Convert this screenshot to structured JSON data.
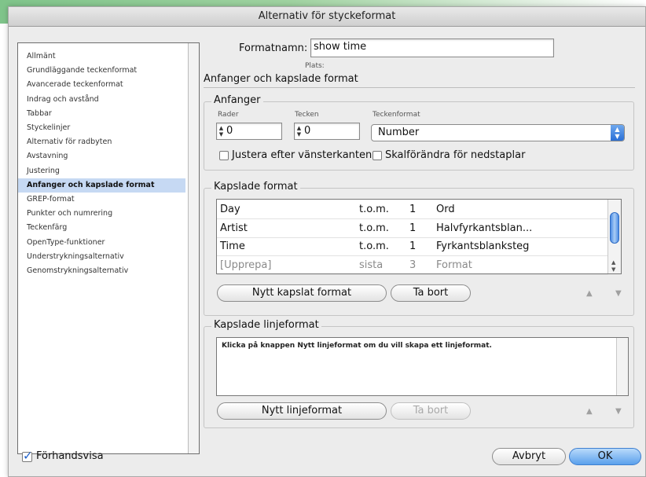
{
  "window": {
    "title": "Alternativ för styckeformat"
  },
  "sidebar": {
    "items": [
      {
        "label": "Allmänt"
      },
      {
        "label": "Grundläggande teckenformat"
      },
      {
        "label": "Avancerade teckenformat"
      },
      {
        "label": "Indrag och avstånd"
      },
      {
        "label": "Tabbar"
      },
      {
        "label": "Styckelinjer"
      },
      {
        "label": "Alternativ för radbyten"
      },
      {
        "label": "Avstavning"
      },
      {
        "label": "Justering"
      },
      {
        "label": "Anfanger och kapslade format",
        "selected": true
      },
      {
        "label": "GREP-format"
      },
      {
        "label": "Punkter och numrering"
      },
      {
        "label": "Teckenfärg"
      },
      {
        "label": "OpenType-funktioner"
      },
      {
        "label": "Understrykningsalternativ"
      },
      {
        "label": "Genomstrykningsalternativ"
      }
    ]
  },
  "header": {
    "style_name_label": "Formatnamn:",
    "style_name_value": "show time",
    "location_label": "Plats:",
    "section_title": "Anfanger och kapslade format"
  },
  "drop_caps": {
    "group_title": "Anfanger",
    "lines_label": "Rader",
    "lines_value": "0",
    "chars_label": "Tecken",
    "chars_value": "0",
    "char_style_label": "Teckenformat",
    "char_style_value": "Number",
    "align_left_label": "Justera efter vänsterkanten",
    "align_left_checked": false,
    "scale_descenders_label": "Skalförändra för nedstaplar",
    "scale_descenders_checked": false
  },
  "nested_styles": {
    "group_title": "Kapslade format",
    "rows": [
      {
        "style": "Day",
        "mode": "t.o.m.",
        "count": "1",
        "unit": "Ord"
      },
      {
        "style": "Artist",
        "mode": "t.o.m.",
        "count": "1",
        "unit": "Halvfyrkantsblan..."
      },
      {
        "style": "Time",
        "mode": "t.o.m.",
        "count": "1",
        "unit": "Fyrkantsblanksteg"
      },
      {
        "style": "[Upprepa]",
        "mode": "sista",
        "count": "3",
        "unit": "Format"
      }
    ],
    "new_button": "Nytt kapslat format",
    "delete_button": "Ta bort",
    "up_arrow": "▲",
    "down_arrow": "▼"
  },
  "nested_lines": {
    "group_title": "Kapslade linjeformat",
    "hint": "Klicka på knappen Nytt linjeformat om du vill skapa ett linjeformat.",
    "new_button": "Nytt linjeformat",
    "delete_button": "Ta bort",
    "up_arrow": "▲",
    "down_arrow": "▼"
  },
  "footer": {
    "preview_label": "Förhandsvisa",
    "preview_checked": true,
    "cancel_button": "Avbryt",
    "ok_button": "OK"
  },
  "colors": {
    "accent": "#3f7fcf",
    "selection": "#c6d9f3",
    "dialog_bg": "#ececec"
  }
}
